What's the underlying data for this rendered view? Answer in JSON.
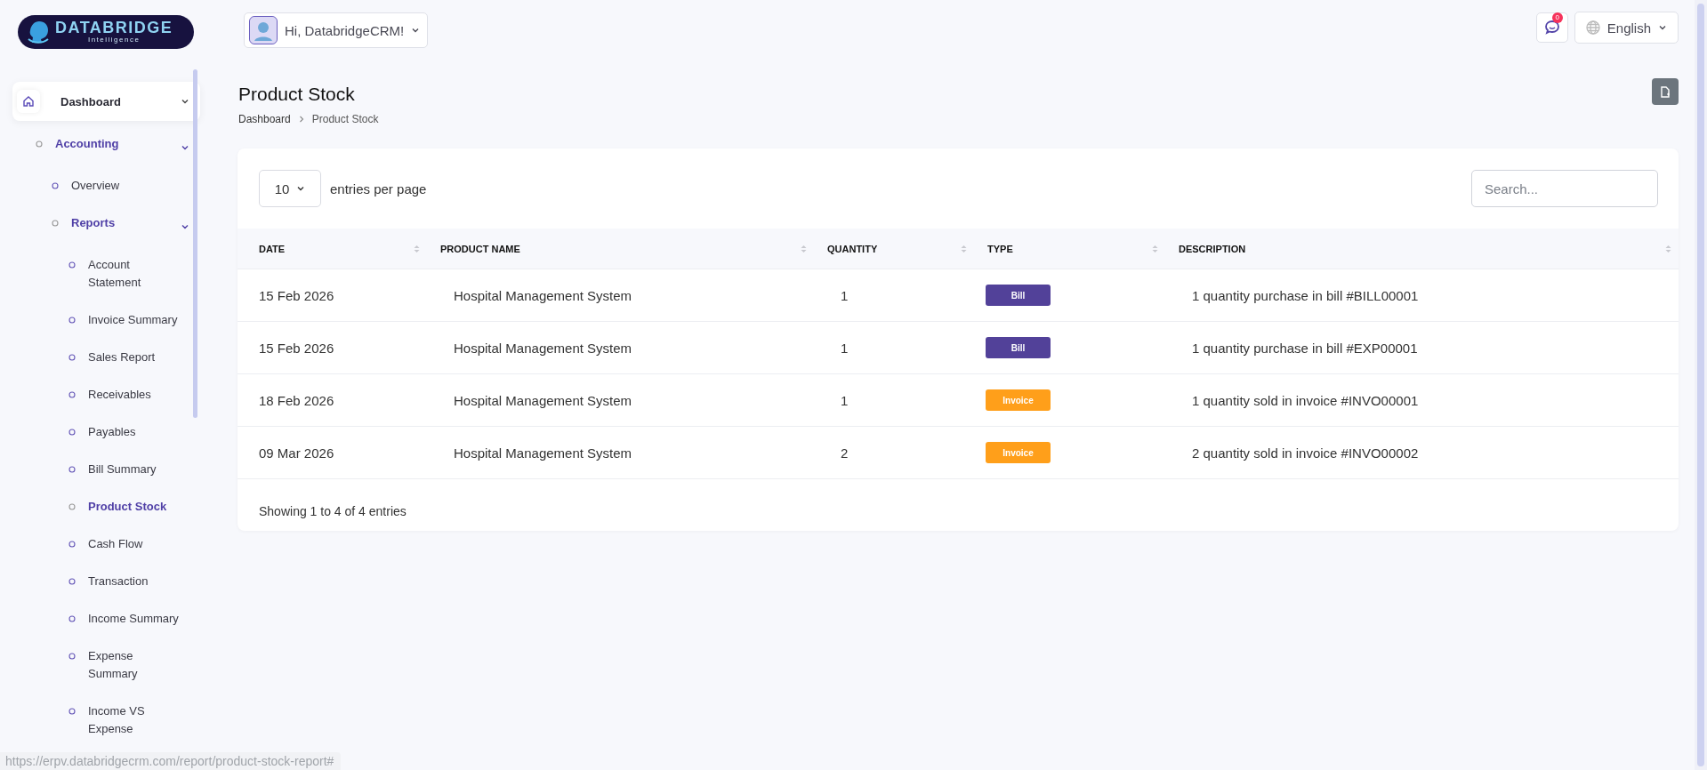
{
  "header": {
    "logo": {
      "title": "DATABRIDGE",
      "subtitle": "Intelligence"
    },
    "greeting": "Hi, DatabridgeCRM!",
    "notifications": {
      "count": "0"
    },
    "language": "English"
  },
  "sidebar": {
    "items": [
      {
        "label": "Dashboard",
        "expanded": true,
        "active": false,
        "children": [
          {
            "label": "Accounting",
            "expanded": true,
            "active": true,
            "children": [
              {
                "label": "Overview",
                "active": false
              },
              {
                "label": "Reports",
                "expanded": true,
                "active": true,
                "children": [
                  {
                    "label": "Account Statement",
                    "active": false
                  },
                  {
                    "label": "Invoice Summary",
                    "active": false
                  },
                  {
                    "label": "Sales Report",
                    "active": false
                  },
                  {
                    "label": "Receivables",
                    "active": false
                  },
                  {
                    "label": "Payables",
                    "active": false
                  },
                  {
                    "label": "Bill Summary",
                    "active": false
                  },
                  {
                    "label": "Product Stock",
                    "active": true
                  },
                  {
                    "label": "Cash Flow",
                    "active": false
                  },
                  {
                    "label": "Transaction",
                    "active": false
                  },
                  {
                    "label": "Income Summary",
                    "active": false
                  },
                  {
                    "label": "Expense Summary",
                    "active": false
                  },
                  {
                    "label": "Income VS Expense",
                    "active": false
                  }
                ]
              }
            ]
          }
        ]
      }
    ]
  },
  "page": {
    "title": "Product Stock",
    "breadcrumb": [
      "Dashboard",
      "Product Stock"
    ]
  },
  "table": {
    "page_size": "10",
    "page_size_label": "entries per page",
    "search": {
      "placeholder": "Search..."
    },
    "columns": [
      "DATE",
      "PRODUCT NAME",
      "QUANTITY",
      "TYPE",
      "DESCRIPTION"
    ],
    "rows": [
      {
        "date": "15 Feb 2026",
        "product": "Hospital Management System",
        "quantity": "1",
        "type": {
          "label": "Bill",
          "color": "#524199"
        },
        "description": "1 quantity purchase in bill #BILL00001"
      },
      {
        "date": "15 Feb 2026",
        "product": "Hospital Management System",
        "quantity": "1",
        "type": {
          "label": "Bill",
          "color": "#524199"
        },
        "description": "1 quantity purchase in bill #EXP00001"
      },
      {
        "date": "18 Feb 2026",
        "product": "Hospital Management System",
        "quantity": "1",
        "type": {
          "label": "Invoice",
          "color": "#ff9f1a"
        },
        "description": "1 quantity sold in invoice #INVO00001"
      },
      {
        "date": "09 Mar 2026",
        "product": "Hospital Management System",
        "quantity": "2",
        "type": {
          "label": "Invoice",
          "color": "#ff9f1a"
        },
        "description": "2 quantity sold in invoice #INVO00002"
      }
    ],
    "footer": "Showing 1 to 4 of 4 entries"
  },
  "status_url": "https://erpv.databridgecrm.com/report/product-stock-report#"
}
